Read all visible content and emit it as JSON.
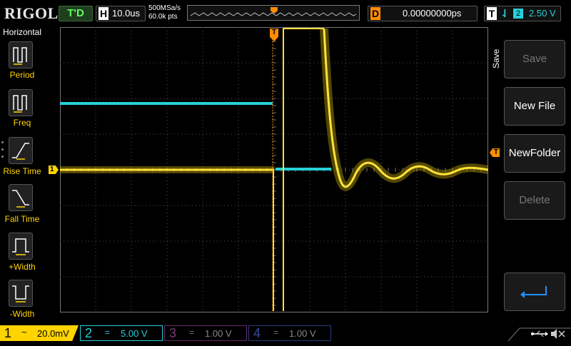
{
  "topbar": {
    "logo": "RIGOL",
    "run_status": "T'D",
    "horizontal_key": "H",
    "timebase": "10.0us",
    "sample_rate": "500MSa/s",
    "memory_points": "60.0k pts",
    "trigger_delay_key": "D",
    "trigger_delay": "0.00000000ps",
    "trigger_key": "T",
    "trigger_channel": "2",
    "trigger_level": "2.50 V"
  },
  "left_menu": {
    "title": "Horizontal",
    "items": [
      {
        "label": "Period",
        "icon": "period-icon"
      },
      {
        "label": "Freq",
        "icon": "frequency-icon"
      },
      {
        "label": "Rise Time",
        "icon": "rise-time-icon"
      },
      {
        "label": "Fall Time",
        "icon": "fall-time-icon"
      },
      {
        "label": "+Width",
        "icon": "positive-width-icon"
      },
      {
        "label": "-Width",
        "icon": "negative-width-icon"
      }
    ]
  },
  "right_menu": {
    "title": "Save",
    "buttons": [
      {
        "label": "Save",
        "enabled": false
      },
      {
        "label": "New File",
        "enabled": true
      },
      {
        "label": "NewFolder",
        "enabled": true
      },
      {
        "label": "Delete",
        "enabled": false
      },
      {
        "label": "",
        "icon": "return-arrow-icon",
        "enabled": true
      }
    ]
  },
  "markers": {
    "ch1_marker": "1",
    "trigger_marker": "T"
  },
  "channels": [
    {
      "num": "1",
      "coupling": "~",
      "scale": "20.0mV",
      "color": "#ffd400",
      "active": true
    },
    {
      "num": "2",
      "coupling": "=",
      "scale": "5.00 V",
      "color": "#27d0d8",
      "active": true
    },
    {
      "num": "3",
      "coupling": "=",
      "scale": "1.00 V",
      "color": "#d040d0",
      "active": false
    },
    {
      "num": "4",
      "coupling": "=",
      "scale": "1.00 V",
      "color": "#3a6cff",
      "active": false
    }
  ],
  "colors": {
    "ch1": "#ffd400",
    "ch2": "#27d0d8",
    "trigger": "#ff8c00",
    "grid": "#555555"
  }
}
